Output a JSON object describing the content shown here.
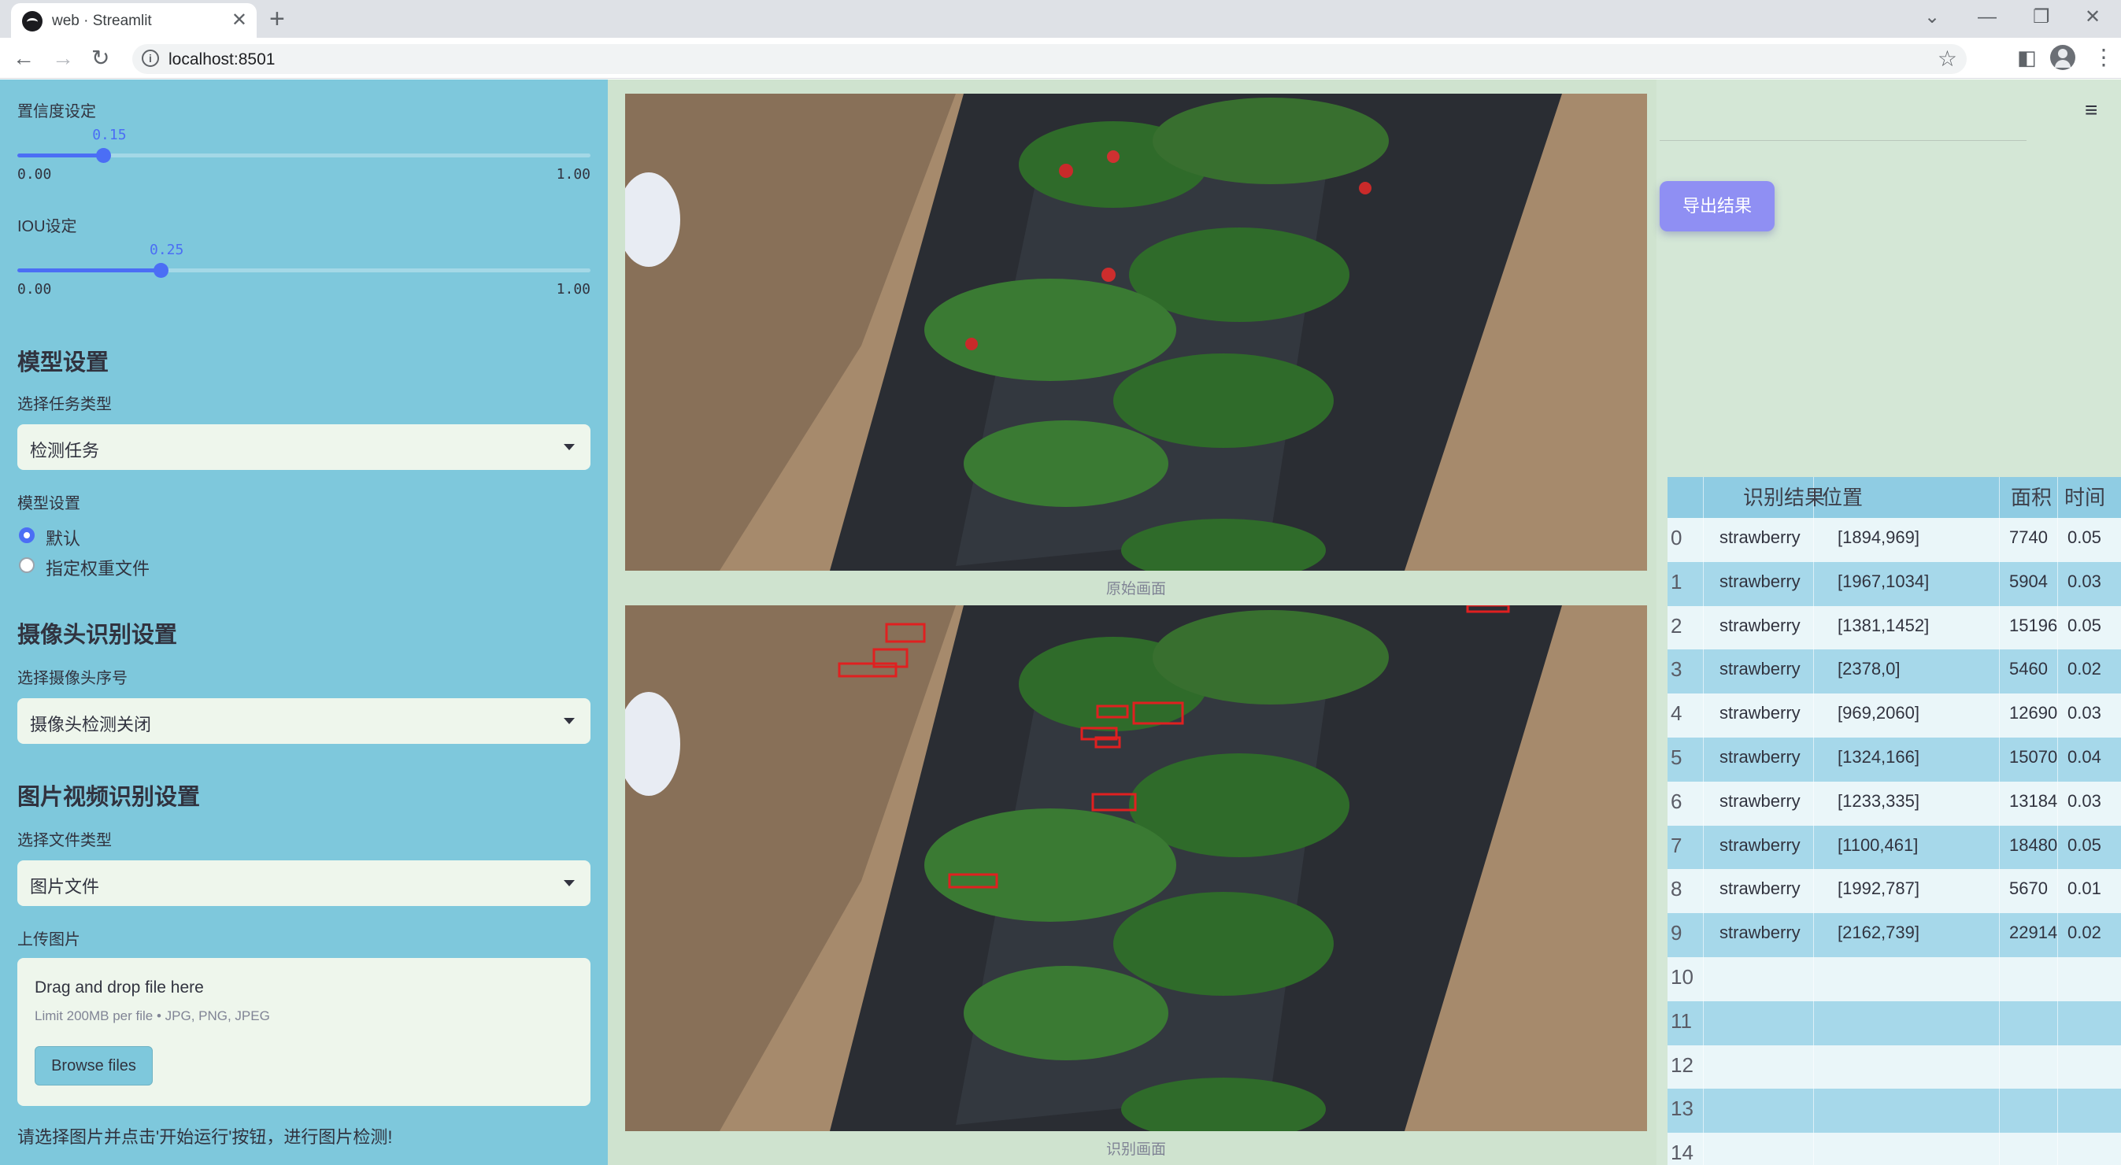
{
  "browser": {
    "tab_title": "web · Streamlit",
    "url": "localhost:8501",
    "new_tab_glyph": "+",
    "close_glyph": "✕"
  },
  "sidebar": {
    "confidence": {
      "label": "置信度设定",
      "value": "0.15",
      "min": "0.00",
      "max": "1.00",
      "fraction": 0.15
    },
    "iou": {
      "label": "IOU设定",
      "value": "0.25",
      "min": "0.00",
      "max": "1.00",
      "fraction": 0.25
    },
    "model_section": {
      "heading": "模型设置",
      "task_label": "选择任务类型",
      "task_value": "检测任务",
      "model_label": "模型设置",
      "options": [
        "默认",
        "指定权重文件"
      ],
      "selected": "默认"
    },
    "camera_section": {
      "heading": "摄像头识别设置",
      "camera_label": "选择摄像头序号",
      "camera_value": "摄像头检测关闭"
    },
    "media_section": {
      "heading": "图片视频识别设置",
      "file_type_label": "选择文件类型",
      "file_type_value": "图片文件",
      "upload_label": "上传图片",
      "drop_title": "Drag and drop file here",
      "drop_hint": "Limit 200MB per file • JPG, PNG, JPEG",
      "browse_label": "Browse files"
    },
    "footer_hint": "请选择图片并点击'开始运行'按钮，进行图片检测!"
  },
  "main": {
    "original_caption": "原始画面",
    "detected_caption": "识别画面",
    "export_label": "导出结果",
    "menu_icon": "hamburger-icon"
  },
  "results_table": {
    "columns": [
      "",
      "识别结果",
      "位置",
      "面积",
      "时间"
    ],
    "rows": [
      {
        "index": "0",
        "label": "strawberry",
        "position": "[1894,969]",
        "area": "7740",
        "time": "0.05"
      },
      {
        "index": "1",
        "label": "strawberry",
        "position": "[1967,1034]",
        "area": "5904",
        "time": "0.03"
      },
      {
        "index": "2",
        "label": "strawberry",
        "position": "[1381,1452]",
        "area": "15196",
        "time": "0.05"
      },
      {
        "index": "3",
        "label": "strawberry",
        "position": "[2378,0]",
        "area": "5460",
        "time": "0.02"
      },
      {
        "index": "4",
        "label": "strawberry",
        "position": "[969,2060]",
        "area": "12690",
        "time": "0.03"
      },
      {
        "index": "5",
        "label": "strawberry",
        "position": "[1324,166]",
        "area": "15070",
        "time": "0.04"
      },
      {
        "index": "6",
        "label": "strawberry",
        "position": "[1233,335]",
        "area": "13184",
        "time": "0.03"
      },
      {
        "index": "7",
        "label": "strawberry",
        "position": "[1100,461]",
        "area": "18480",
        "time": "0.05"
      },
      {
        "index": "8",
        "label": "strawberry",
        "position": "[1992,787]",
        "area": "5670",
        "time": "0.01"
      },
      {
        "index": "9",
        "label": "strawberry",
        "position": "[2162,739]",
        "area": "22914",
        "time": "0.02"
      },
      {
        "index": "10",
        "label": "",
        "position": "",
        "area": "",
        "time": ""
      },
      {
        "index": "11",
        "label": "",
        "position": "",
        "area": "",
        "time": ""
      },
      {
        "index": "12",
        "label": "",
        "position": "",
        "area": "",
        "time": ""
      },
      {
        "index": "13",
        "label": "",
        "position": "",
        "area": "",
        "time": ""
      },
      {
        "index": "14",
        "label": "",
        "position": "",
        "area": "",
        "time": ""
      }
    ]
  },
  "colors": {
    "sidebar_bg": "#7ec8dc",
    "main_bg": "#cfe3cf",
    "accent": "#4b6ef5",
    "export_button": "#8f8ff3",
    "detection_box": "#e02020"
  }
}
